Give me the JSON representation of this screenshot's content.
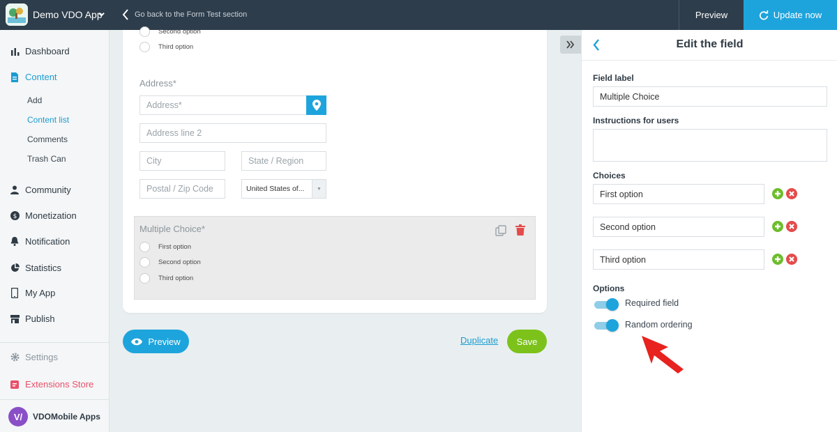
{
  "topbar": {
    "app_name": "Demo VDO App",
    "back_label": "Go back to the Form Test section",
    "preview_label": "Preview",
    "update_label": "Update now",
    "accent_color": "#1ea4dc"
  },
  "sidebar": {
    "items": [
      {
        "label": "Dashboard",
        "icon": "bar-chart-icon"
      },
      {
        "label": "Content",
        "icon": "document-icon",
        "active": true
      },
      {
        "label": "Community",
        "icon": "person-icon"
      },
      {
        "label": "Monetization",
        "icon": "dollar-icon"
      },
      {
        "label": "Notification",
        "icon": "bell-icon"
      },
      {
        "label": "Statistics",
        "icon": "pie-chart-icon"
      },
      {
        "label": "My App",
        "icon": "phone-icon"
      },
      {
        "label": "Publish",
        "icon": "store-icon"
      }
    ],
    "content_sub": [
      "Add",
      "Content list",
      "Comments",
      "Trash Can"
    ],
    "active_sub": "Content list",
    "settings_label": "Settings",
    "extensions_label": "Extensions Store",
    "org_initial": "V/",
    "org_name": "VDOMobile Apps"
  },
  "form": {
    "top_radios": [
      "Second option",
      "Third option"
    ],
    "address": {
      "label": "Address*",
      "address_placeholder": "Address*",
      "line2_placeholder": "Address line 2",
      "city_placeholder": "City",
      "state_placeholder": "State / Region",
      "zip_placeholder": "Postal / Zip Code",
      "country_value": "United States of..."
    },
    "multiple_choice": {
      "label": "Multiple Choice*",
      "options": [
        "First option",
        "Second option",
        "Third option"
      ]
    },
    "preview_label": "Preview",
    "duplicate_label": "Duplicate",
    "save_label": "Save"
  },
  "panel": {
    "title": "Edit the field",
    "field_label_label": "Field label",
    "field_label_value": "Multiple Choice",
    "instructions_label": "Instructions for users",
    "instructions_value": "",
    "choices_label": "Choices",
    "choices": [
      "First option",
      "Second option",
      "Third option"
    ],
    "options_label": "Options",
    "options": [
      {
        "label": "Required field",
        "on": true
      },
      {
        "label": "Random ordering",
        "on": true
      }
    ]
  }
}
